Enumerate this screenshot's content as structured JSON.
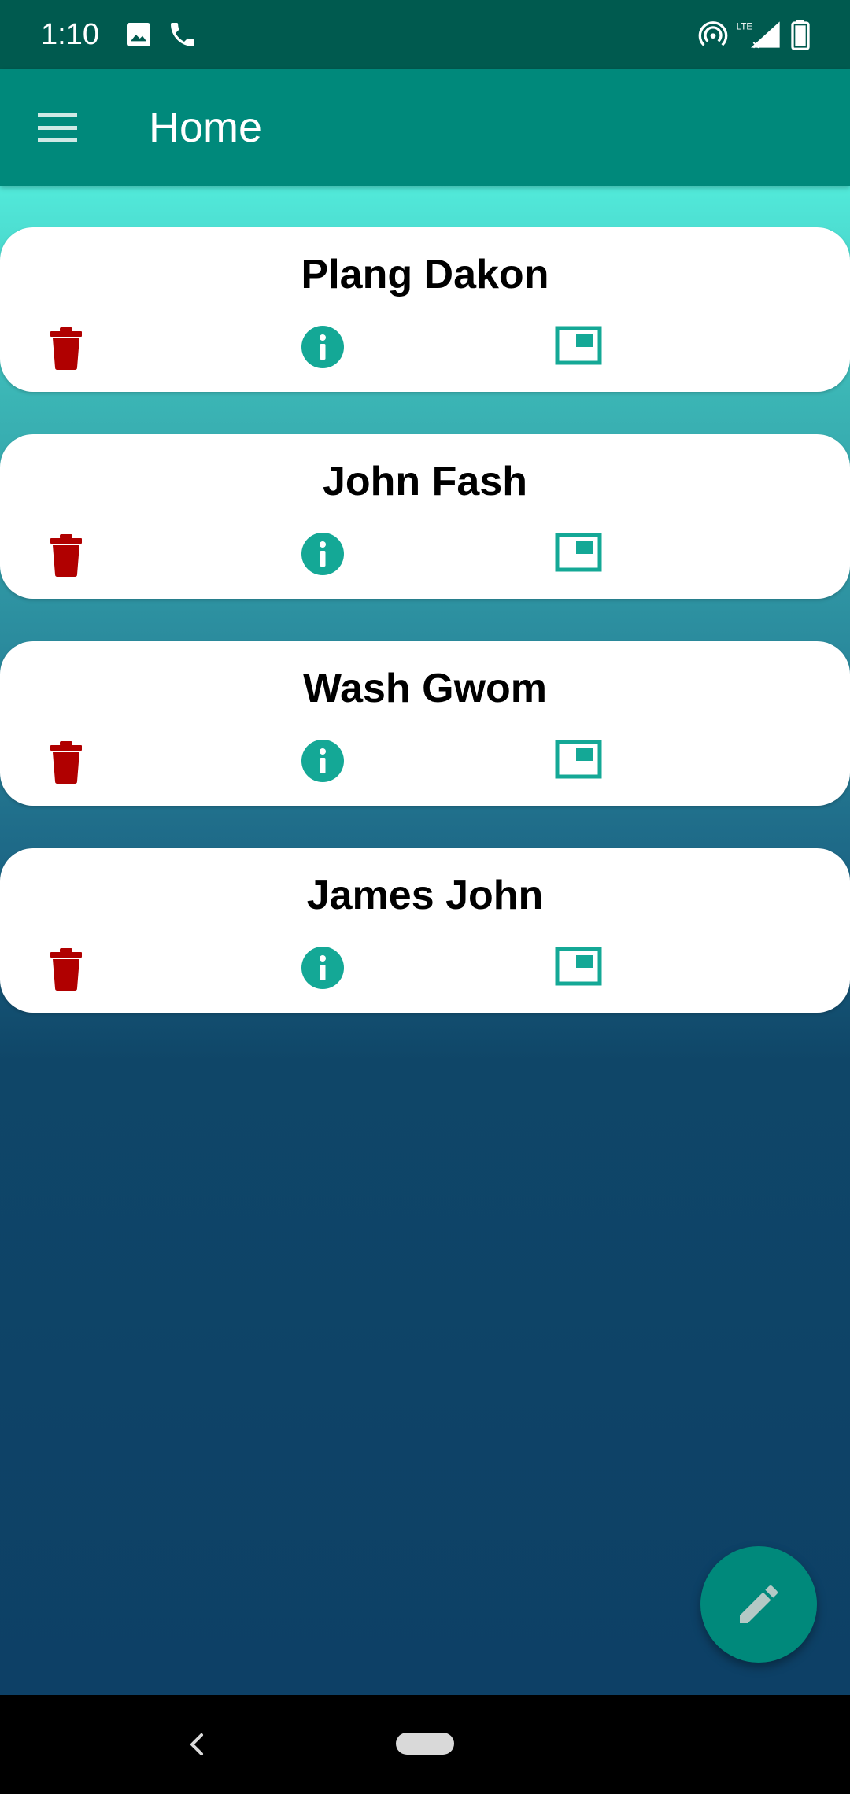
{
  "status_bar": {
    "time": "1:10",
    "icons": [
      "image-icon",
      "phone-icon",
      "hotspot-icon",
      "lte-signal-icon",
      "battery-icon"
    ],
    "network_label": "LTE"
  },
  "app_bar": {
    "title": "Home",
    "menu_icon": "menu-icon"
  },
  "contacts": [
    {
      "name": "Plang Dakon"
    },
    {
      "name": "John Fash"
    },
    {
      "name": "Wash Gwom"
    },
    {
      "name": "James John"
    }
  ],
  "card_actions": {
    "delete_icon": "trash-icon",
    "info_icon": "info-icon",
    "view_icon": "picture-in-picture-icon"
  },
  "fab": {
    "icon": "pencil-icon"
  },
  "colors": {
    "status_bar": "#005a4f",
    "app_bar": "#00897b",
    "accent": "#14a896",
    "delete": "#b00000",
    "gradient_top": "#52eada",
    "gradient_bottom": "#0d4066"
  }
}
